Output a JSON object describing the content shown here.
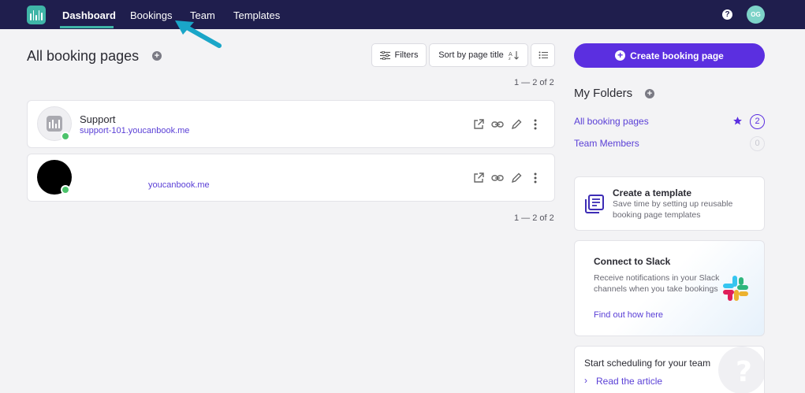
{
  "nav": {
    "items": [
      "Dashboard",
      "Bookings",
      "Team",
      "Templates"
    ],
    "help": "?",
    "avatar_initials": "OG"
  },
  "header": {
    "title": "All booking pages",
    "filters_label": "Filters",
    "sort_label": "Sort by page title",
    "count_top": "1 — 2 of 2",
    "count_bottom": "1 — 2 of 2"
  },
  "booking_pages": [
    {
      "name": "Support",
      "link": "support-101.youcanbook.me"
    },
    {
      "name": "",
      "link": "youcanbook.me"
    }
  ],
  "sidebar": {
    "create_label": "Create booking page",
    "folders_title": "My Folders",
    "folders": [
      {
        "label": "All booking pages",
        "count": "2"
      },
      {
        "label": "Team Members",
        "count": "0"
      }
    ],
    "template_card": {
      "title": "Create a template",
      "text": "Save time by setting up reusable booking page templates"
    },
    "slack_card": {
      "title": "Connect to Slack",
      "text": "Receive notifications in your Slack channels when you take bookings",
      "link": "Find out how here"
    },
    "schedule_card": {
      "title": "Start scheduling for your team",
      "link": "Read the article"
    }
  },
  "colors": {
    "nav_bg": "#1f1e4d",
    "accent": "#5b2fe0",
    "teal": "#3fb5a7",
    "status_green": "#4cc36b"
  }
}
